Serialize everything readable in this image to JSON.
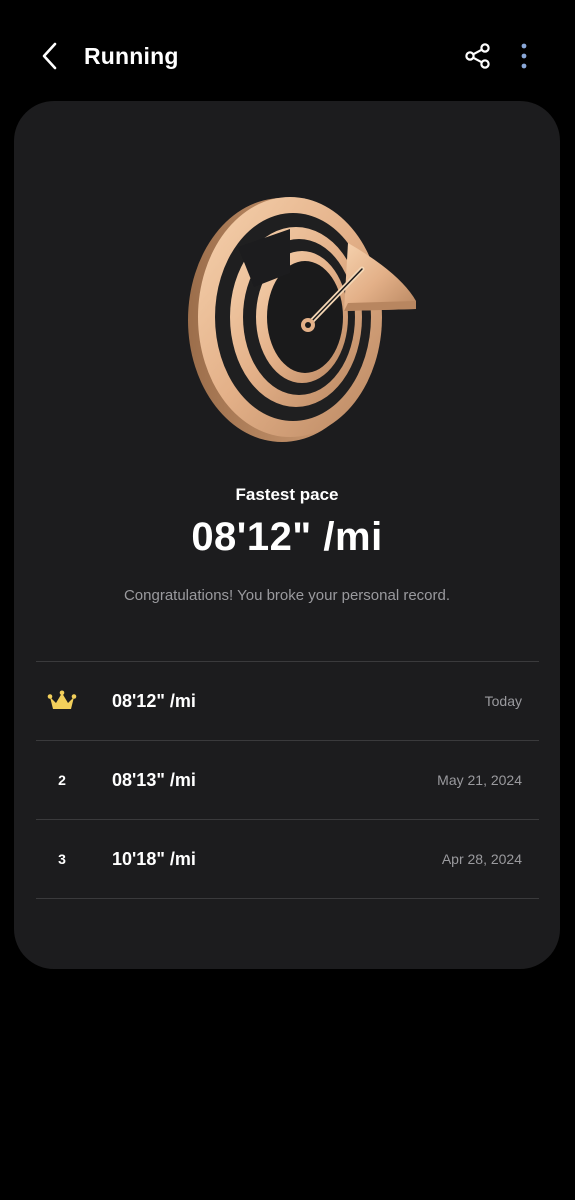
{
  "header": {
    "title": "Running",
    "back_icon": "chevron-left-icon",
    "share_icon": "share-icon",
    "more_icon": "more-vertical-icon"
  },
  "record": {
    "label": "Fastest pace",
    "value": "08'12\" /mi",
    "message": "Congratulations! You broke your personal record.",
    "medal_icon": "speedometer-medal-icon"
  },
  "history": [
    {
      "rank": "",
      "rank_icon": "crown-icon",
      "pace": "08'12\" /mi",
      "date": "Today"
    },
    {
      "rank": "2",
      "pace": "08'13\" /mi",
      "date": "May 21, 2024"
    },
    {
      "rank": "3",
      "pace": "10'18\" /mi",
      "date": "Apr 28, 2024"
    }
  ],
  "colors": {
    "background": "#000000",
    "card": "#1c1c1e",
    "divider": "#3a3a3c",
    "secondary_text": "#9a9a9e",
    "medal_gold": "#e8b98f",
    "crown": "#f2cf5b",
    "more_dots": "#8aa8d8"
  }
}
